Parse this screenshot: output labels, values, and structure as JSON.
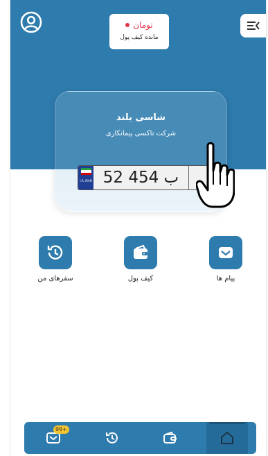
{
  "colors": {
    "primary": "#2e7bad",
    "accent_red": "#e0354a",
    "badge": "#f4c430"
  },
  "header": {
    "profile_icon": "user-circle-icon",
    "menu_icon": "menu-collapse-icon",
    "wallet": {
      "amount": "تومان",
      "label": "مانده کیف پول"
    }
  },
  "driver_card": {
    "name": "شاسی بلند",
    "company": "شرکت تاکسی پیمانکاری",
    "plate": {
      "country": "I.R. IRAN",
      "number": "52 ب 454",
      "region": ""
    }
  },
  "actions": [
    {
      "label": "سفرهای من",
      "icon": "history-icon"
    },
    {
      "label": "کیف پول",
      "icon": "wallet-icon"
    },
    {
      "label": "پیام ها",
      "icon": "mail-icon"
    }
  ],
  "bottom_nav": {
    "items": [
      {
        "icon": "messages-icon",
        "badge": "99+"
      },
      {
        "icon": "history-icon"
      },
      {
        "icon": "wallet-icon"
      },
      {
        "icon": "home-icon",
        "active": true
      }
    ]
  }
}
